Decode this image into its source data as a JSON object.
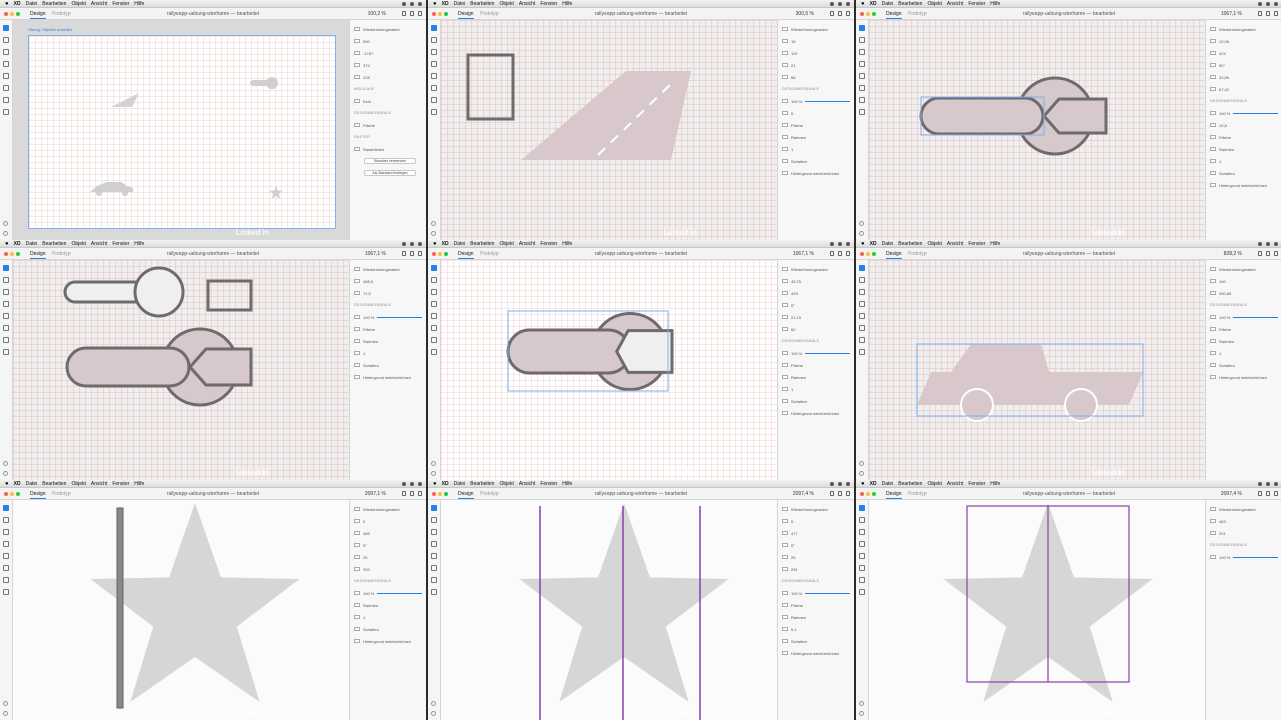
{
  "menubar": {
    "app": "XD",
    "items": [
      "Datei",
      "Bearbeiten",
      "Objekt",
      "Ansicht",
      "Fenster",
      "Hilfe"
    ]
  },
  "window": {
    "tabs": {
      "design": "Design",
      "prototype": "Prototyp"
    },
    "title": "rallyeapp-uebung-wireframe — bearbeitet"
  },
  "watermark": "Linked in",
  "cells": [
    {
      "zoom": "100,2 %",
      "artboard_label": "Übung: Objekte erstellen",
      "panel": [
        "Wiederholungsraster",
        "590",
        "-1787",
        "374",
        "228",
        "WEIGLAUF",
        "Kein",
        "DESIGNMERKMALE",
        "Fläche",
        "RASTER",
        "Rasterlinien",
        "Standard verwenden",
        "Als Standard festlegen"
      ]
    },
    {
      "zoom": "300,5 %",
      "panel": [
        "Wiederholungsraster",
        "15",
        "119",
        "21",
        "66",
        "DESIGNMERKMALE",
        "100 %",
        "0",
        "Fläche",
        "Rahmen",
        "1",
        "Schatten",
        "Hintergrund weichzeichnen"
      ]
    },
    {
      "zoom": "1067,1 %",
      "panel": [
        "Wiederholungsraster",
        "10,36",
        "424",
        "90°",
        "33,89",
        "67,42",
        "DESIGNMERKMALE",
        "100 %",
        "10,8",
        "Fläche",
        "Rahmen",
        "1",
        "Schatten",
        "Hintergrund weichzeichnen"
      ]
    },
    {
      "zoom": "1067,1 %",
      "panel": [
        "Wiederholungsraster",
        "468,5",
        "71,5",
        "DESIGNMERKMALE",
        "100 %",
        "Fläche",
        "Rahmen",
        "1",
        "Schatten",
        "Hintergrund weichzeichnen"
      ]
    },
    {
      "zoom": "1067,1 %",
      "panel": [
        "Wiederholungsraster",
        "45,75",
        "429",
        "0°",
        "21,19",
        "62",
        "DESIGNMERKMALE",
        "100 %",
        "Fläche",
        "Rahmen",
        "1",
        "Schatten",
        "Hintergrund weichzeichnen"
      ]
    },
    {
      "zoom": "828,2 %",
      "panel": [
        "Wiederholungsraster",
        "100",
        "390,68",
        "DESIGNMERKMALE",
        "100 %",
        "Fläche",
        "Rahmen",
        "1",
        "Schatten",
        "Hintergrund weichzeichnen"
      ]
    },
    {
      "zoom": "2097,1 %",
      "panel": [
        "Wiederholungsraster",
        "0",
        "466",
        "0°",
        "25",
        "292",
        "DESIGNMERKMALE",
        "100 %",
        "Rahmen",
        "1",
        "Schatten",
        "Hintergrund weichzeichnen"
      ]
    },
    {
      "zoom": "2097,4 %",
      "panel": [
        "Wiederholungsraster",
        "0",
        "477",
        "0°",
        "25",
        "291",
        "DESIGNMERKMALE",
        "100 %",
        "Fläche",
        "Rahmen",
        "0,1",
        "Schatten",
        "Hintergrund weichzeichnen"
      ]
    },
    {
      "zoom": "2097,4 %",
      "panel": [
        "Wiederholungsraster",
        "483",
        "291",
        "DESIGNMERKMALE",
        "100 %"
      ]
    }
  ]
}
